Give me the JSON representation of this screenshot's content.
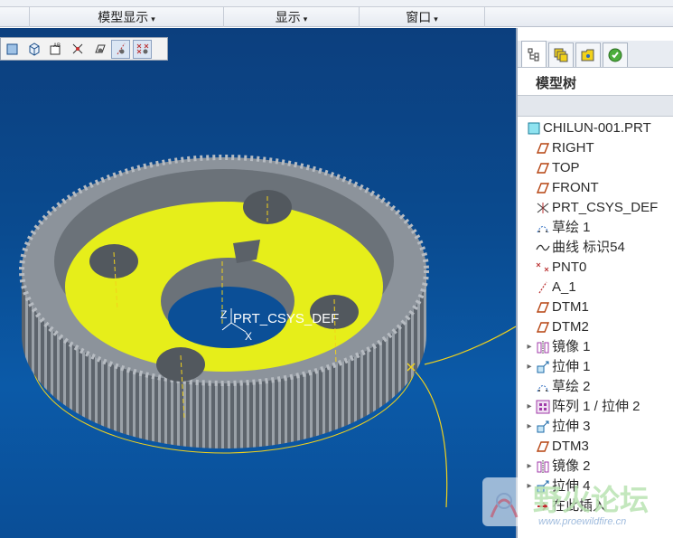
{
  "ribbon": {
    "groups": [
      {
        "label": "模型显示",
        "caret": "▾"
      },
      {
        "label": "显示",
        "caret": "▾"
      },
      {
        "label": "窗口",
        "caret": "▾"
      }
    ]
  },
  "viewport": {
    "csys_label": "PRT_CSYS_DEF",
    "axis_z": "Z",
    "axis_x": "X"
  },
  "panel": {
    "title": "模型树",
    "tree": [
      {
        "label": "CHILUN-001.PRT",
        "icon": "part-icon",
        "expandable": false,
        "root": true
      },
      {
        "label": "RIGHT",
        "icon": "datum-plane-icon",
        "expandable": false
      },
      {
        "label": "TOP",
        "icon": "datum-plane-icon",
        "expandable": false
      },
      {
        "label": "FRONT",
        "icon": "datum-plane-icon",
        "expandable": false
      },
      {
        "label": "PRT_CSYS_DEF",
        "icon": "csys-icon",
        "expandable": false
      },
      {
        "label": "草绘 1",
        "icon": "sketch-icon",
        "expandable": false
      },
      {
        "label": "曲线 标识54",
        "icon": "curve-icon",
        "expandable": false
      },
      {
        "label": "PNT0",
        "icon": "datum-point-icon",
        "expandable": false
      },
      {
        "label": "A_1",
        "icon": "datum-axis-icon",
        "expandable": false
      },
      {
        "label": "DTM1",
        "icon": "datum-plane-icon",
        "expandable": false
      },
      {
        "label": "DTM2",
        "icon": "datum-plane-icon",
        "expandable": false
      },
      {
        "label": "镜像 1",
        "icon": "mirror-icon",
        "expandable": true
      },
      {
        "label": "拉伸 1",
        "icon": "extrude-icon",
        "expandable": true
      },
      {
        "label": "草绘 2",
        "icon": "sketch-icon",
        "expandable": false
      },
      {
        "label": "阵列 1 / 拉伸 2",
        "icon": "pattern-icon",
        "expandable": true
      },
      {
        "label": "拉伸 3",
        "icon": "extrude-icon",
        "expandable": true
      },
      {
        "label": "DTM3",
        "icon": "datum-plane-icon",
        "expandable": false
      },
      {
        "label": "镜像 2",
        "icon": "mirror-icon",
        "expandable": true
      },
      {
        "label": "拉伸 4",
        "icon": "extrude-icon",
        "expandable": true
      },
      {
        "label": "在此插入",
        "icon": "insert-here-icon",
        "expandable": false
      }
    ]
  },
  "watermark": {
    "text": "野火论坛",
    "url": "www.proewildfire.cn"
  },
  "colors": {
    "viewport_bg": "#0b4f97",
    "gear_gray": "#8c939b",
    "gear_face": "#e6ee1a",
    "datum_yellow": "#f2d21b"
  }
}
